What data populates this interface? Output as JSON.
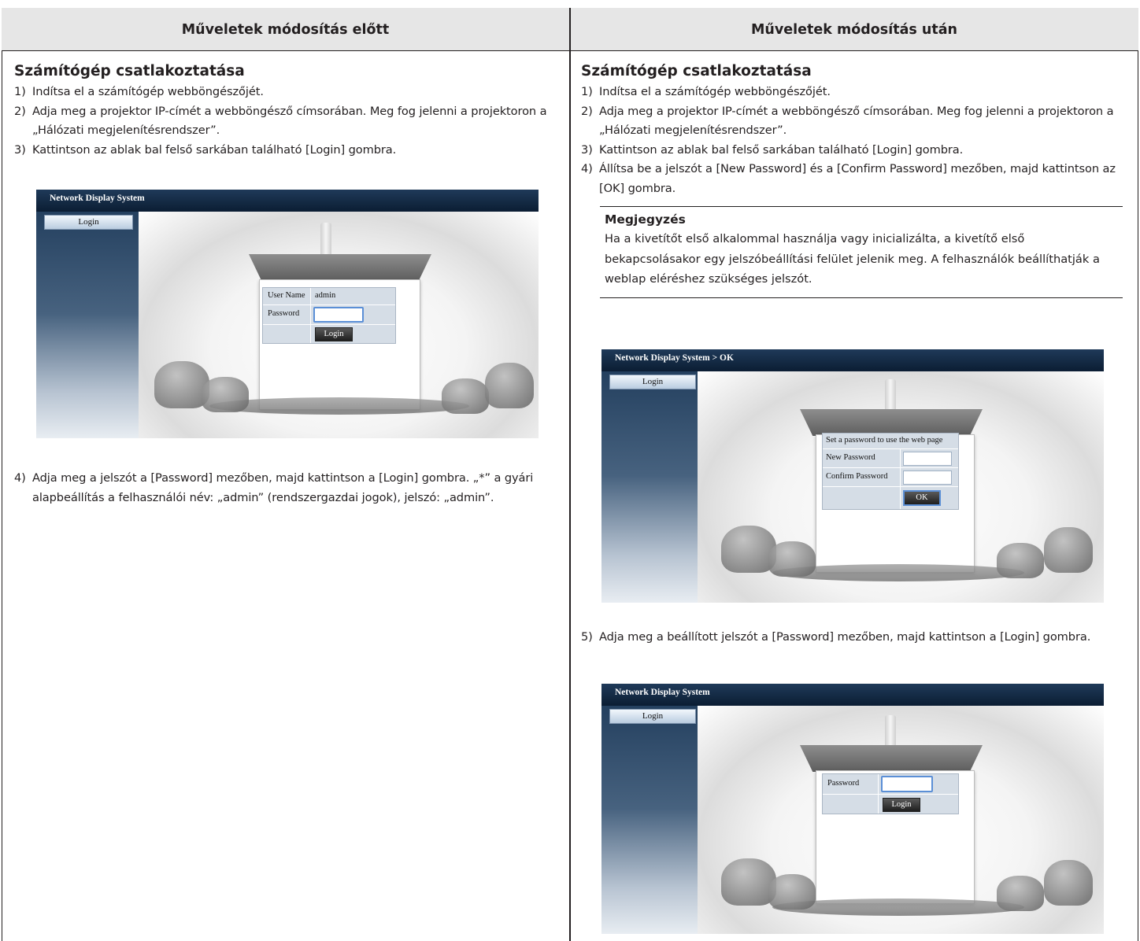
{
  "header": {
    "left": "Műveletek módosítás előtt",
    "right": "Műveletek módosítás után"
  },
  "left": {
    "title": "Számítógép csatlakoztatása",
    "steps": [
      {
        "num": "1)",
        "text": "Indítsa el a számítógép webböngészőjét."
      },
      {
        "num": "2)",
        "text": "Adja meg a projektor IP-címét a webböngésző címsorában. Meg fog jelenni a projektoron a „Hálózati megjelenítésrendszer”."
      },
      {
        "num": "3)",
        "text": "Kattintson az ablak bal felső sarkában található [Login] gombra."
      }
    ],
    "step4": {
      "num": "4)",
      "text": "Adja meg a jelszót a [Password] mezőben, majd kattintson a [Login] gombra. „*” a gyári alapbeállítás a felhasználói név: „admin” (rendszergazdai jogok), jelszó: „admin”."
    }
  },
  "right": {
    "title": "Számítógép csatlakoztatása",
    "steps": [
      {
        "num": "1)",
        "text": "Indítsa el a számítógép webböngészőjét."
      },
      {
        "num": "2)",
        "text": "Adja meg a projektor IP-címét a webböngésző címsorában. Meg fog jelenni a projektoron a „Hálózati megjelenítésrendszer”."
      },
      {
        "num": "3)",
        "text": "Kattintson az ablak bal felső sarkában található [Login] gombra."
      },
      {
        "num": "4)",
        "text": "Állítsa be a jelszót a [New Password] és a [Confirm Password] mezőben, majd kattintson az [OK] gombra."
      }
    ],
    "note": {
      "title": "Megjegyzés",
      "text": "Ha a kivetítőt első alkalommal használja vagy inicializálta, a kivetítő első bekapcsolásakor egy jelszóbeállítási felület jelenik meg. A felhasználók beállíthatják a weblap eléréshez szükséges jelszót."
    },
    "step5": {
      "num": "5)",
      "text": "Adja meg a beállított jelszót a [Password] mezőben, majd kattintson a [Login] gombra."
    }
  },
  "shots": {
    "login_admin": {
      "title": "Network Display System",
      "side_button": "Login",
      "user_label": "User Name",
      "user_value": "admin",
      "password_label": "Password",
      "login_button": "Login"
    },
    "set_password": {
      "title": "Network Display System > OK",
      "side_button": "Login",
      "heading": "Set a password to use the web page",
      "new_label": "New Password",
      "confirm_label": "Confirm Password",
      "ok_button": "OK"
    },
    "login_password": {
      "title": "Network Display System",
      "side_button": "Login",
      "password_label": "Password",
      "login_button": "Login"
    }
  }
}
